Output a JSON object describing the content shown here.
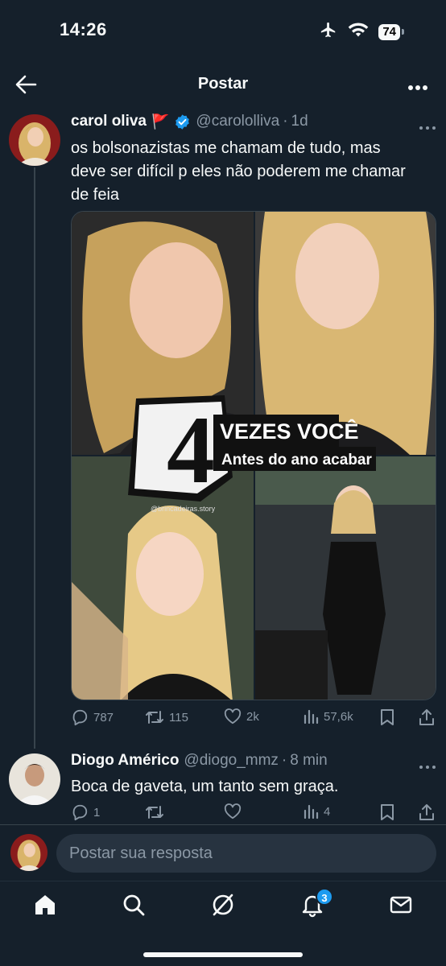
{
  "status_bar": {
    "time": "14:26",
    "battery": "74"
  },
  "header": {
    "title": "Postar"
  },
  "tweet": {
    "name": "carol oliva",
    "flag": "🚩",
    "handle": "@carololliva",
    "time": "1d",
    "text_lines": [
      "os bolsonazistas me chamam de tudo, mas",
      "deve ser difícil p eles não poderem me chamar",
      "de feia"
    ],
    "media": {
      "big_number": "4",
      "line1": "VEZES VOCÊ",
      "line2": "Antes do ano acabar",
      "watermark": "@brincadeiras.story"
    },
    "replies": "787",
    "reposts": "115",
    "likes": "2k",
    "views": "57,6k"
  },
  "reply": {
    "name": "Diogo Américo",
    "handle": "@diogo_mmz",
    "time": "8 min",
    "text": "Boca de gaveta, um tanto sem graça.",
    "replies": "1",
    "views": "4"
  },
  "composer": {
    "placeholder": "Postar sua resposta"
  },
  "nav": {
    "notifications_badge": "3"
  },
  "colors": {
    "background": "#15202b",
    "accent": "#1d9bf0",
    "muted": "#8b98a5"
  }
}
